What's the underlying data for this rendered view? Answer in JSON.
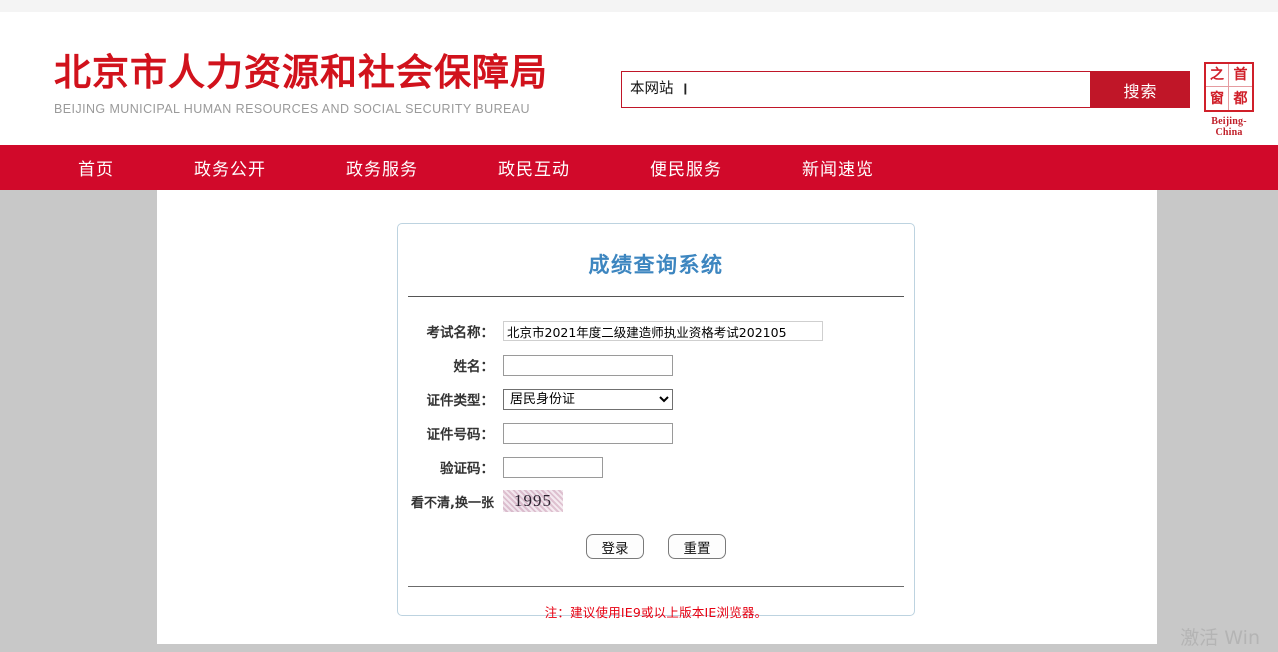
{
  "header": {
    "brand_cn": "北京市人力资源和社会保障局",
    "brand_en": "BEIJING MUNICIPAL HUMAN RESOURCES AND SOCIAL SECURITY BUREAU",
    "brand_color": "#d1121c",
    "search": {
      "scope_selected": "本网站",
      "scope_options": [
        "本网站"
      ],
      "input_value": "",
      "input_placeholder": "",
      "button_label": "搜索",
      "button_color": "#c01628"
    },
    "city_logo": {
      "seal_chars": [
        "之",
        "首",
        "窗",
        "都"
      ],
      "caption": "Beijing-China",
      "color": "#d0202a"
    }
  },
  "nav": {
    "background": "#d1092a",
    "items": [
      {
        "label": "首页"
      },
      {
        "label": "政务公开"
      },
      {
        "label": "政务服务"
      },
      {
        "label": "政民互动"
      },
      {
        "label": "便民服务"
      },
      {
        "label": "新闻速览"
      }
    ]
  },
  "card": {
    "title": "成绩查询系统",
    "title_color": "#3d86c0",
    "fields": {
      "exam_name": {
        "label": "考试名称：",
        "value": "北京市2021年度二级建造师执业资格考试202105"
      },
      "name": {
        "label": "姓名：",
        "value": "",
        "placeholder": ""
      },
      "id_type": {
        "label": "证件类型：",
        "selected": "居民身份证",
        "options": [
          "居民身份证"
        ]
      },
      "id_number": {
        "label": "证件号码：",
        "value": "",
        "placeholder": ""
      },
      "captcha": {
        "label": "验证码：",
        "value": "",
        "placeholder": ""
      }
    },
    "captcha_refresh": {
      "label": "看不清,换一张",
      "image_text": "1995"
    },
    "buttons": {
      "login": "登录",
      "reset": "重置"
    },
    "note": "注：建议使用IE9或以上版本IE浏览器。",
    "note_color": "#e60012"
  },
  "watermark": {
    "text": "激活 Win"
  }
}
